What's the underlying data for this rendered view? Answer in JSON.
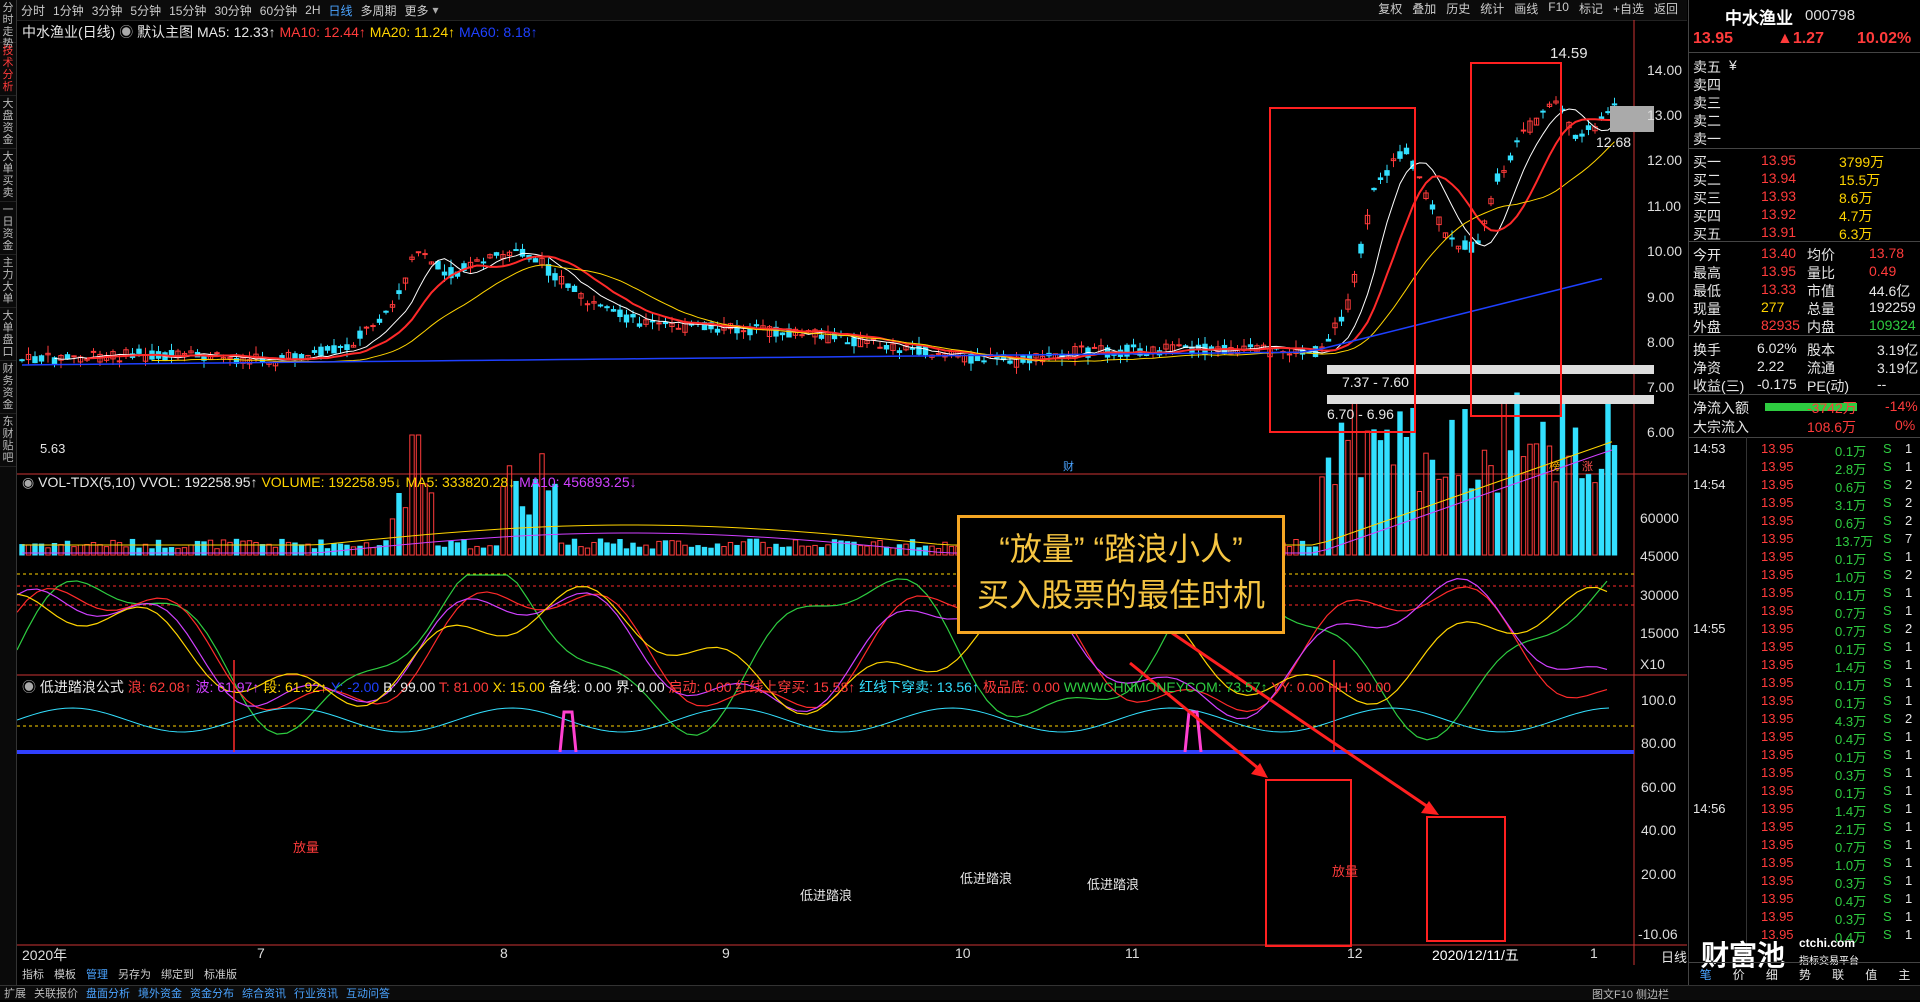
{
  "sidebar": {
    "tabs": [
      "分时走势",
      "技术分析",
      "大盘资金",
      "大单买卖",
      "一日资金",
      "主力大单",
      "大单盘口",
      "财务资金",
      "东财贴吧"
    ]
  },
  "topbar": {
    "periods": [
      "分时",
      "1分钟",
      "3分钟",
      "5分钟",
      "15分钟",
      "30分钟",
      "60分钟",
      "2H",
      "日线",
      "多周期",
      "更多"
    ],
    "active_period": "日线",
    "tools": [
      "复权",
      "叠加",
      "历史",
      "统计",
      "画线",
      "F10",
      "标记",
      "+自选",
      "返回"
    ]
  },
  "main_chart": {
    "stock_label": "中水渔业(日线)",
    "template_label": "默认主图",
    "ma5": "MA5: 12.33↑",
    "ma10": "MA10: 12.44↑",
    "ma20": "MA20: 11.24↑",
    "ma60": "MA60: 8.18↑",
    "y_ticks": [
      "14.00",
      "13.00",
      "12.00",
      "11.00",
      "10.00",
      "9.00",
      "8.00",
      "7.00",
      "6.00"
    ],
    "high_label": "14.59",
    "low_label": "5.63",
    "current_label": "12.68",
    "zone1": "7.37 - 7.60",
    "zone2": "6.70 - 6.96",
    "marker_cai": "财",
    "marker_bang": "榜",
    "marker_zhang": "涨"
  },
  "volume_chart": {
    "title": "VOL-TDX(5,10)",
    "vvol": "VVOL: 192258.95↑",
    "volume": "VOLUME: 192258.95↓",
    "ma5": "MA5: 333820.28↓",
    "ma10": "MA10: 456893.25↓",
    "y_ticks": [
      "60000",
      "45000",
      "30000",
      "15000",
      "X10"
    ]
  },
  "indicator_chart": {
    "name": "低进踏浪公式",
    "lang": "浪: 62.08↑",
    "bo": "波: 61.97↑",
    "duan": "段: 61.92↑",
    "y": "Y: -2.00",
    "b": "B: 99.00",
    "t": "T: 81.00",
    "x": "X: 15.00",
    "beixian": "备线: 0.00",
    "jie": "界: 0.00",
    "qidong": "启动: 0.00",
    "hongxian_up": "红线上穿买: 15.58↑",
    "hongxian_down": "红线下穿卖: 13.56↑",
    "jidi": "极品底: 0.00",
    "www": "WWWCHNMONEYCOM: 73.57↑",
    "yy": "YY: 0.00",
    "hh": "HH: 90.00",
    "y_ticks": [
      "100.0",
      "80.00",
      "60.00",
      "40.00",
      "20.00",
      "-10.06"
    ],
    "label_fangliang1": "放量",
    "label_fangliang2": "放量",
    "label_dijin1": "低进踏浪",
    "label_dijin2": "低进踏浪",
    "label_dijin3": "低进踏浪"
  },
  "x_axis": {
    "labels": [
      "2020年",
      "7",
      "8",
      "9",
      "10",
      "11",
      "12",
      "2020/12/11/五",
      "1"
    ]
  },
  "callout": {
    "line1": "“放量”  “踏浪小人”",
    "line2": "买入股票的最佳时机"
  },
  "toolbar2": [
    "指标",
    "模板",
    "管理",
    "另存为",
    "绑定到",
    "标准版"
  ],
  "bottombar": [
    "扩展",
    "关联报价",
    "盘面分析",
    "境外资金",
    "资金分布",
    "综合资讯",
    "行业资讯",
    "互动问答"
  ],
  "bottom_right": "图文F10 侧边栏",
  "quote": {
    "name": "中水渔业",
    "code": "000798",
    "price": "13.95",
    "change": "▲1.27",
    "pct": "10.02%",
    "sell_labels": [
      "卖五",
      "卖四",
      "卖三",
      "卖二",
      "卖一"
    ],
    "sell5_flag": "¥",
    "buy": [
      {
        "label": "买一",
        "price": "13.95",
        "vol": "3799万"
      },
      {
        "label": "买二",
        "price": "13.94",
        "vol": "15.5万"
      },
      {
        "label": "买三",
        "price": "13.93",
        "vol": "8.6万"
      },
      {
        "label": "买四",
        "price": "13.92",
        "vol": "4.7万"
      },
      {
        "label": "买五",
        "price": "13.91",
        "vol": "6.3万"
      }
    ],
    "stats": [
      {
        "l1": "今开",
        "v1": "13.40",
        "l2": "均价",
        "v2": "13.78"
      },
      {
        "l1": "最高",
        "v1": "13.95",
        "l2": "量比",
        "v2": "0.49"
      },
      {
        "l1": "最低",
        "v1": "13.33",
        "l2": "市值",
        "v2": "44.6亿"
      },
      {
        "l1": "现量",
        "v1": "277",
        "l2": "总量",
        "v2": "192259"
      },
      {
        "l1": "外盘",
        "v1": "82935",
        "l2": "内盘",
        "v2": "109324"
      }
    ],
    "stats2": [
      {
        "l1": "换手",
        "v1": "6.02%",
        "l2": "股本",
        "v2": "3.19亿"
      },
      {
        "l1": "净资",
        "v1": "2.22",
        "l2": "流通",
        "v2": "3.19亿"
      },
      {
        "l1": "收益(三)",
        "v1": "-0.175",
        "l2": "PE(动)",
        "v2": "--"
      }
    ],
    "netflow_label": "净流入额",
    "netflow_value": "-3742万",
    "netflow_pct": "-14%",
    "block_label": "大宗流入",
    "block_value": "108.6万",
    "block_pct": "0%",
    "ticks": [
      {
        "time": "14:53",
        "price": "13.95",
        "vol": "0.1万",
        "n": "S",
        "c": "1"
      },
      {
        "time": "",
        "price": "13.95",
        "vol": "2.8万",
        "n": "S",
        "c": "1"
      },
      {
        "time": "14:54",
        "price": "13.95",
        "vol": "0.6万",
        "n": "S",
        "c": "2"
      },
      {
        "time": "",
        "price": "13.95",
        "vol": "3.1万",
        "n": "S",
        "c": "2"
      },
      {
        "time": "",
        "price": "13.95",
        "vol": "0.6万",
        "n": "S",
        "c": "2"
      },
      {
        "time": "",
        "price": "13.95",
        "vol": "13.7万",
        "n": "S",
        "c": "7"
      },
      {
        "time": "",
        "price": "13.95",
        "vol": "0.1万",
        "n": "S",
        "c": "1"
      },
      {
        "time": "",
        "price": "13.95",
        "vol": "1.0万",
        "n": "S",
        "c": "2"
      },
      {
        "time": "",
        "price": "13.95",
        "vol": "0.1万",
        "n": "S",
        "c": "1"
      },
      {
        "time": "",
        "price": "13.95",
        "vol": "0.7万",
        "n": "S",
        "c": "1"
      },
      {
        "time": "14:55",
        "price": "13.95",
        "vol": "0.7万",
        "n": "S",
        "c": "2"
      },
      {
        "time": "",
        "price": "13.95",
        "vol": "0.1万",
        "n": "S",
        "c": "1"
      },
      {
        "time": "",
        "price": "13.95",
        "vol": "1.4万",
        "n": "S",
        "c": "1"
      },
      {
        "time": "",
        "price": "13.95",
        "vol": "0.1万",
        "n": "S",
        "c": "1"
      },
      {
        "time": "",
        "price": "13.95",
        "vol": "0.1万",
        "n": "S",
        "c": "1"
      },
      {
        "time": "",
        "price": "13.95",
        "vol": "4.3万",
        "n": "S",
        "c": "2"
      },
      {
        "time": "",
        "price": "13.95",
        "vol": "0.4万",
        "n": "S",
        "c": "1"
      },
      {
        "time": "",
        "price": "13.95",
        "vol": "0.1万",
        "n": "S",
        "c": "1"
      },
      {
        "time": "",
        "price": "13.95",
        "vol": "0.3万",
        "n": "S",
        "c": "1"
      },
      {
        "time": "",
        "price": "13.95",
        "vol": "0.1万",
        "n": "S",
        "c": "1"
      },
      {
        "time": "14:56",
        "price": "13.95",
        "vol": "1.4万",
        "n": "S",
        "c": "1"
      },
      {
        "time": "",
        "price": "13.95",
        "vol": "2.1万",
        "n": "S",
        "c": "1"
      },
      {
        "time": "",
        "price": "13.95",
        "vol": "0.7万",
        "n": "S",
        "c": "1"
      },
      {
        "time": "",
        "price": "13.95",
        "vol": "1.0万",
        "n": "S",
        "c": "1"
      },
      {
        "time": "",
        "price": "13.95",
        "vol": "0.3万",
        "n": "S",
        "c": "1"
      },
      {
        "time": "",
        "price": "13.95",
        "vol": "0.4万",
        "n": "S",
        "c": "1"
      },
      {
        "time": "",
        "price": "13.95",
        "vol": "0.3万",
        "n": "S",
        "c": "1"
      },
      {
        "time": "",
        "price": "13.95",
        "vol": "0.4万",
        "n": "S",
        "c": "1"
      }
    ],
    "tick_tabs": [
      "笔",
      "价",
      "细",
      "势",
      "联",
      "值",
      "主"
    ],
    "watermark_name": "财富池",
    "watermark_url": "ctchi.com",
    "watermark_sub": "指标交易平台",
    "day_label": "日线"
  },
  "colors": {
    "up": "#ff3b3b",
    "down": "#33e0ff",
    "ma5": "#ffffff",
    "ma10": "#ff2a2a",
    "ma20": "#ffd400",
    "ma60": "#1e40ff",
    "annotation": "#ff2020",
    "callout": "#f5a623"
  }
}
